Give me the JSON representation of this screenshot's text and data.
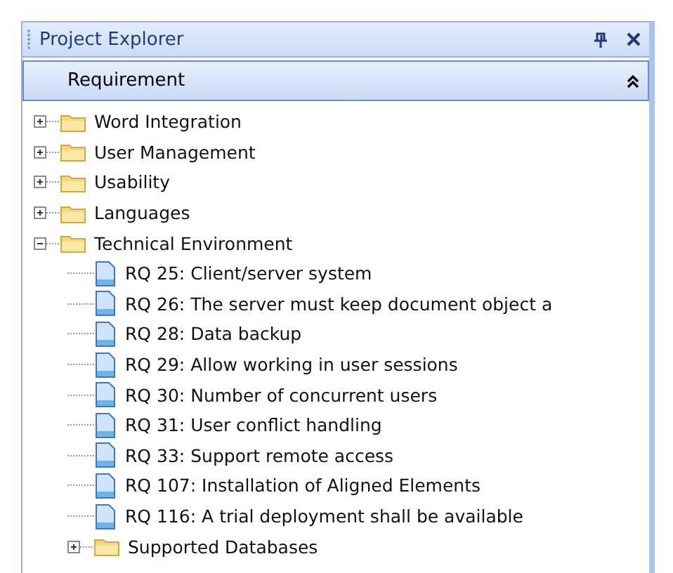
{
  "panel": {
    "title": "Project Explorer"
  },
  "section": {
    "title": "Requirement",
    "expanded": true
  },
  "tree": [
    {
      "kind": "folder",
      "label": "Word Integration",
      "expanded": false
    },
    {
      "kind": "folder",
      "label": "User Management",
      "expanded": false
    },
    {
      "kind": "folder",
      "label": "Usability",
      "expanded": false
    },
    {
      "kind": "folder",
      "label": "Languages",
      "expanded": false
    },
    {
      "kind": "folder",
      "label": "Technical Environment",
      "expanded": true,
      "children": [
        {
          "kind": "document",
          "label": "RQ 25: Client/server system"
        },
        {
          "kind": "document",
          "label": "RQ 26: The server must keep document object a"
        },
        {
          "kind": "document",
          "label": "RQ 28: Data backup"
        },
        {
          "kind": "document",
          "label": "RQ 29: Allow working in user sessions"
        },
        {
          "kind": "document",
          "label": "RQ 30: Number of concurrent users"
        },
        {
          "kind": "document",
          "label": "RQ 31: User conflict handling"
        },
        {
          "kind": "document",
          "label": "RQ 33: Support remote access"
        },
        {
          "kind": "document",
          "label": "RQ 107: Installation of Aligned Elements"
        },
        {
          "kind": "document",
          "label": "RQ 116: A trial deployment shall be available"
        },
        {
          "kind": "folder",
          "label": "Supported Databases",
          "expanded": false
        }
      ]
    }
  ]
}
